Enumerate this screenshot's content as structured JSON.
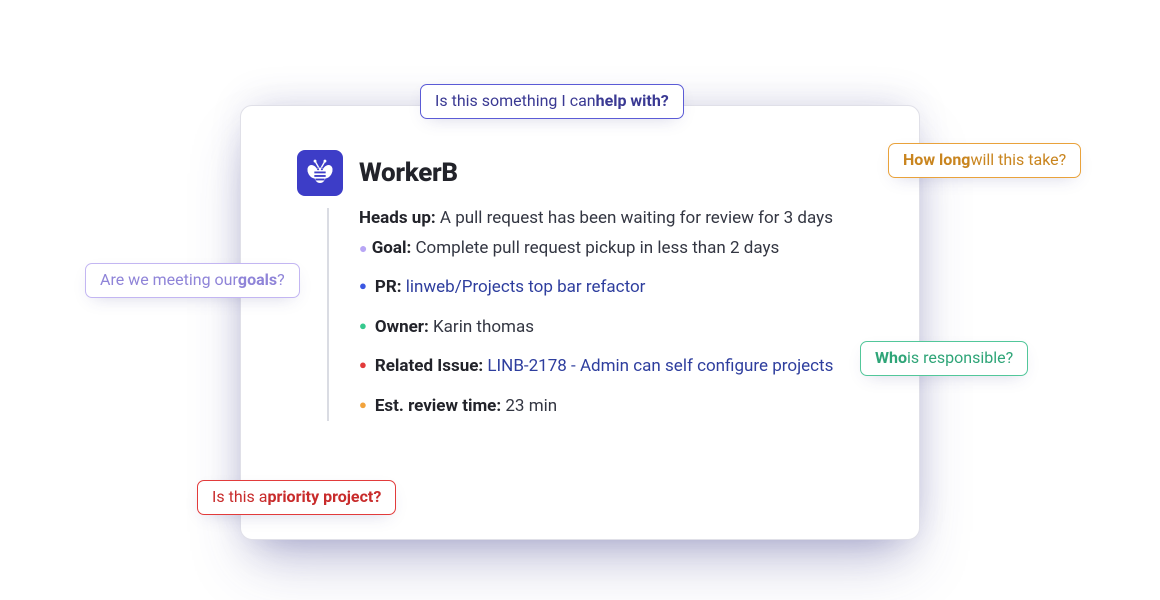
{
  "app": {
    "name": "WorkerB"
  },
  "lead": {
    "label": "Heads up:",
    "text": " A pull request has been waiting for review for 3 days"
  },
  "goal": {
    "label": "Goal:",
    "text": " Complete pull request pickup in less than 2 days"
  },
  "fields": {
    "pr": {
      "label": "PR:",
      "value": "linweb/Projects top bar refactor"
    },
    "owner": {
      "label": "Owner:",
      "value": "Karin thomas"
    },
    "issue": {
      "label": "Related Issue:",
      "value": "LINB-2178  - Admin can self configure projects"
    },
    "est": {
      "label": "Est. review time:",
      "value": "23 min"
    }
  },
  "callouts": {
    "help": {
      "pre": "Is this something I can ",
      "bold": "help with?",
      "post": ""
    },
    "long": {
      "pre": "",
      "bold": "How long",
      "post": " will this take?"
    },
    "goals": {
      "pre": "Are we meeting our ",
      "bold": "goals",
      "post": "?"
    },
    "who": {
      "pre": "",
      "bold": "Who",
      "post": " is responsible?"
    },
    "prio": {
      "pre": "Is this a ",
      "bold": "priority project?",
      "post": ""
    }
  }
}
